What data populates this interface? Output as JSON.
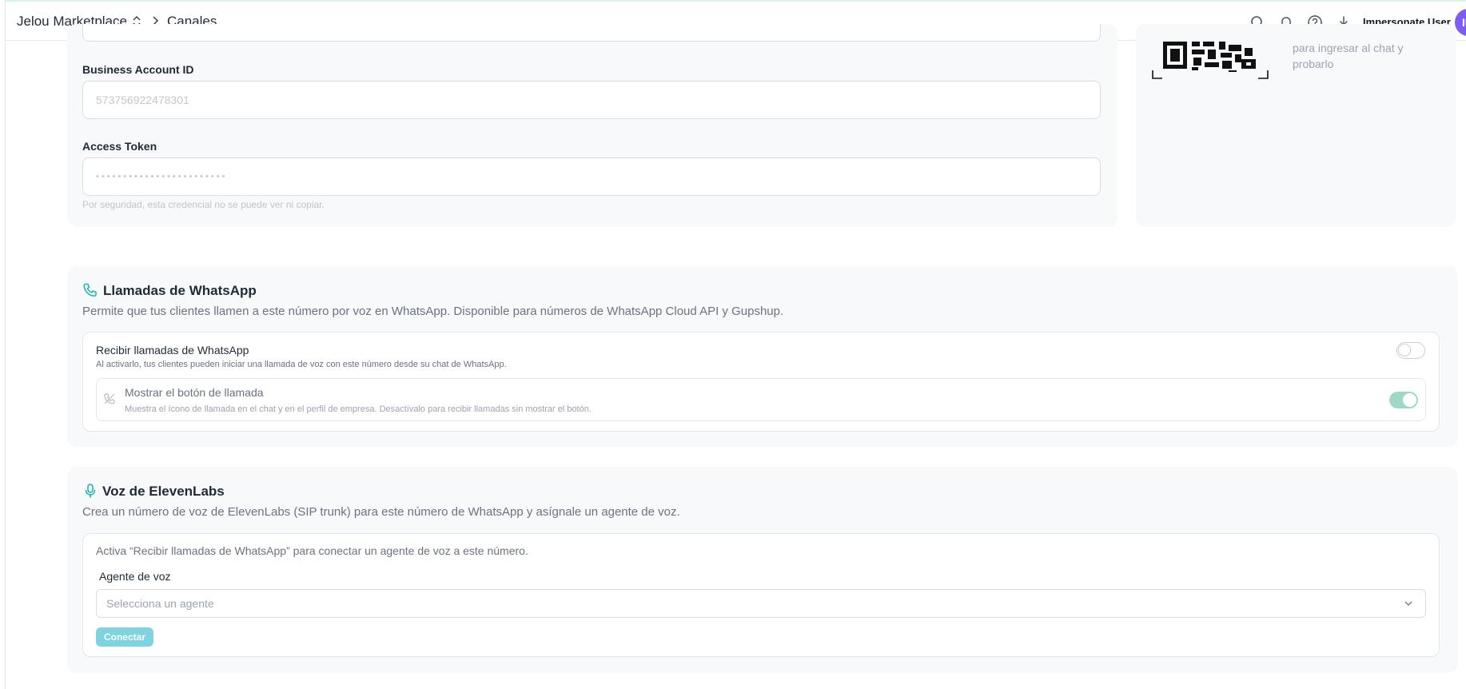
{
  "header": {
    "app_name": "Jelou Marketplace",
    "page_name": "Canales",
    "impersonate_label": "Impersonate User",
    "avatar_initials": "IU",
    "icons": [
      "search-icon",
      "bell-icon",
      "help-icon",
      "download-icon"
    ]
  },
  "credentials": {
    "business_account_label": "Business Account ID",
    "business_account_value": "573756922478301",
    "access_token_label": "Access Token",
    "access_token_value": "••••••••••••••••••••••••",
    "access_token_helper": "Por seguridad, esta credencial no se puede ver ni copiar."
  },
  "qr_panel": {
    "text_line1": "para ingresar al chat y",
    "text_line2": "probarlo"
  },
  "calls": {
    "title": "Llamadas de WhatsApp",
    "description": "Permite que tus clientes llamen a este número por voz en WhatsApp. Disponible para números de WhatsApp Cloud API y Gupshup.",
    "receive": {
      "title": "Recibir llamadas de WhatsApp",
      "subtitle": "Al activarlo, tus clientes pueden iniciar una llamada de voz con este número desde su chat de WhatsApp.",
      "enabled": false
    },
    "show_button": {
      "title": "Mostrar el botón de llamada",
      "subtitle": "Muestra el ícono de llamada en el chat y en el perfil de empresa. Desactívalo para recibir llamadas sin mostrar el botón.",
      "enabled": true
    }
  },
  "voice": {
    "title": "Voz de ElevenLabs",
    "description": "Crea un número de voz de ElevenLabs (SIP trunk) para este número de WhatsApp y asígnale un agente de voz.",
    "notice": "Activa “Recibir llamadas de WhatsApp” para conectar un agente de voz a este número.",
    "agent_label": "Agente de voz",
    "agent_placeholder": "Selecciona un agente",
    "connect_label": "Conectar"
  },
  "colors": {
    "accent_teal": "#14b8a6",
    "avatar": "#7c5cf5",
    "toggle_on": "#9fd8c6",
    "connect_button": "#7dd3e0"
  }
}
